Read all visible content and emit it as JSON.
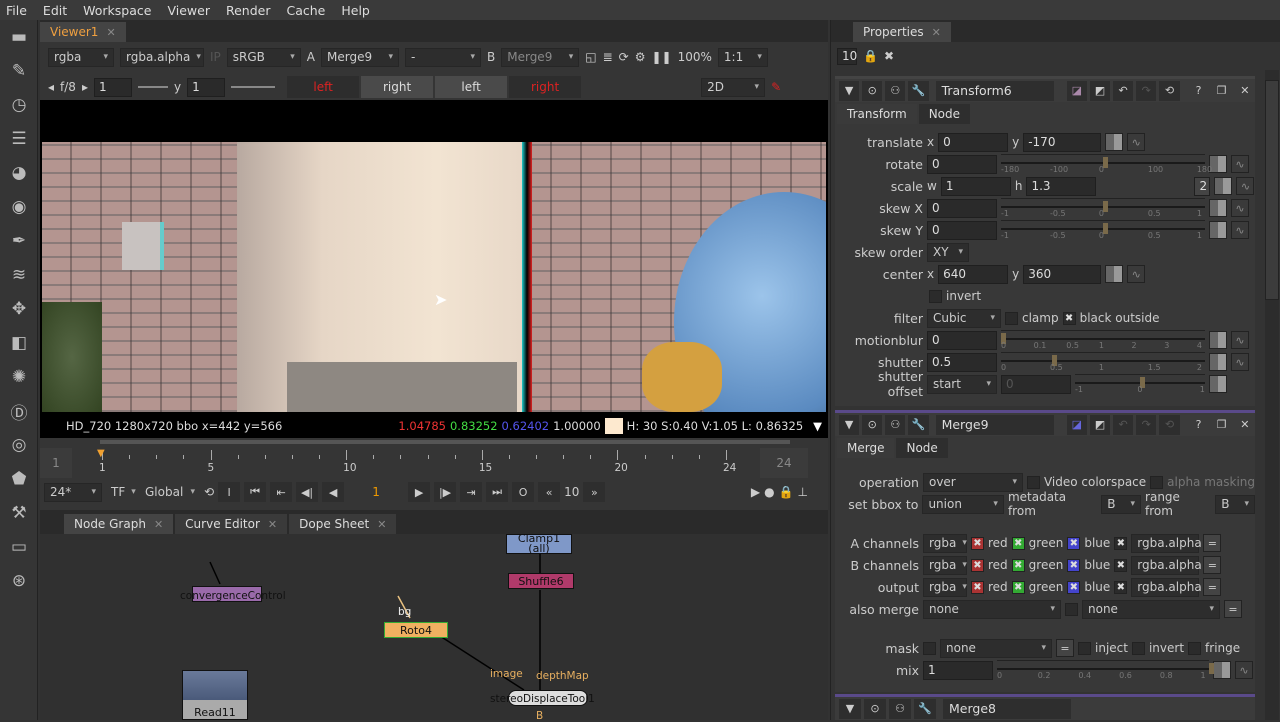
{
  "menu": [
    "File",
    "Edit",
    "Workspace",
    "Viewer",
    "Render",
    "Cache",
    "Help"
  ],
  "viewer": {
    "tab": "Viewer1",
    "channels": "rgba",
    "alpha": "rgba.alpha",
    "ip": "IP",
    "colorspace": "sRGB",
    "a_label": "A",
    "a_input": "Merge9",
    "wipe": "-",
    "b_label": "B",
    "b_input": "Merge9",
    "zoom": "100%",
    "ratio": "1:1",
    "fstop": "f/8",
    "gain": "1",
    "gamma_label": "y",
    "gamma": "1",
    "views": [
      "left",
      "right",
      "left",
      "right"
    ],
    "mode": "2D",
    "info": {
      "format": "HD_720 1280x720  bbo  x=442 y=566",
      "r": "1.04785",
      "g": "0.83252",
      "b": "0.62402",
      "a": "1.00000",
      "hsv": "H: 30 S:0.40 V:1.05  L: 0.86325",
      "swatch": "#fde9cf"
    },
    "timeline": {
      "start": "1",
      "end": "24",
      "current": "1",
      "ticks": [
        "1",
        "5",
        "10",
        "15",
        "20",
        "24"
      ],
      "current_frame": 1,
      "fps": "24*",
      "tf": "TF",
      "scope": "Global",
      "step": "10"
    }
  },
  "bottom_tabs": [
    {
      "label": "Node Graph"
    },
    {
      "label": "Curve Editor"
    },
    {
      "label": "Dope Sheet"
    }
  ],
  "nodes": {
    "convergence": "convergenceControl",
    "clamp": "Clamp1",
    "clamp_sub": "(all)",
    "shuffle": "Shuffle6",
    "roto": "Roto4",
    "roto_in": "bg",
    "read": "Read11",
    "stereo": "stereoDisplaceTool1",
    "image_in": "image",
    "depth_in": "depthMap",
    "b_in": "B"
  },
  "properties": {
    "title": "Properties",
    "count": "10",
    "transform": {
      "name": "Transform6",
      "tabs": [
        "Transform",
        "Node"
      ],
      "translate": {
        "label": "translate",
        "x": "0",
        "y": "-170"
      },
      "rotate": {
        "label": "rotate",
        "value": "0",
        "ticks": [
          "-180",
          "-100",
          "0",
          "100",
          "180"
        ]
      },
      "scale": {
        "label": "scale",
        "w": "1",
        "h": "1.3",
        "n": "2"
      },
      "skewx": {
        "label": "skew X",
        "value": "0"
      },
      "skewy": {
        "label": "skew Y",
        "value": "0"
      },
      "skew_ticks": [
        "-1",
        "-0.5",
        "0",
        "0.5",
        "1"
      ],
      "skew_order": {
        "label": "skew order",
        "value": "XY"
      },
      "center": {
        "label": "center",
        "x": "640",
        "y": "360"
      },
      "invert": "invert",
      "filter": {
        "label": "filter",
        "value": "Cubic",
        "clamp": "clamp",
        "black_outside": "black outside"
      },
      "motionblur": {
        "label": "motionblur",
        "value": "0",
        "ticks": [
          "0",
          "0.1",
          "0.5",
          "1",
          "2",
          "3",
          "4"
        ]
      },
      "shutter": {
        "label": "shutter",
        "value": "0.5",
        "ticks": [
          "0",
          "0.5",
          "1",
          "1.5",
          "2"
        ]
      },
      "shutter_offset": {
        "label": "shutter offset",
        "value": "start",
        "custom": "0",
        "ticks": [
          "-1",
          "0",
          "1"
        ]
      }
    },
    "merge": {
      "name": "Merge9",
      "tabs": [
        "Merge",
        "Node"
      ],
      "operation": {
        "label": "operation",
        "value": "over",
        "video": "Video colorspace",
        "alpha_masking": "alpha masking"
      },
      "bbox": {
        "label": "set bbox to",
        "value": "union",
        "metadata_label": "metadata from",
        "metadata": "B",
        "range_label": "range from",
        "range": "B"
      },
      "channels": [
        {
          "label": "A channels"
        },
        {
          "label": "B channels"
        },
        {
          "label": "output"
        }
      ],
      "chan_value": "rgba",
      "red": "red",
      "green": "green",
      "blue": "blue",
      "alpha": "rgba.alpha",
      "also_merge": {
        "label": "also merge",
        "a": "none",
        "b": "none"
      },
      "mask": {
        "label": "mask",
        "value": "none",
        "inject": "inject",
        "invert": "invert",
        "fringe": "fringe"
      },
      "mix": {
        "label": "mix",
        "value": "1",
        "ticks": [
          "0",
          "0.2",
          "0.4",
          "0.6",
          "0.8",
          "1"
        ]
      }
    },
    "merge8": {
      "name": "Merge8"
    }
  }
}
